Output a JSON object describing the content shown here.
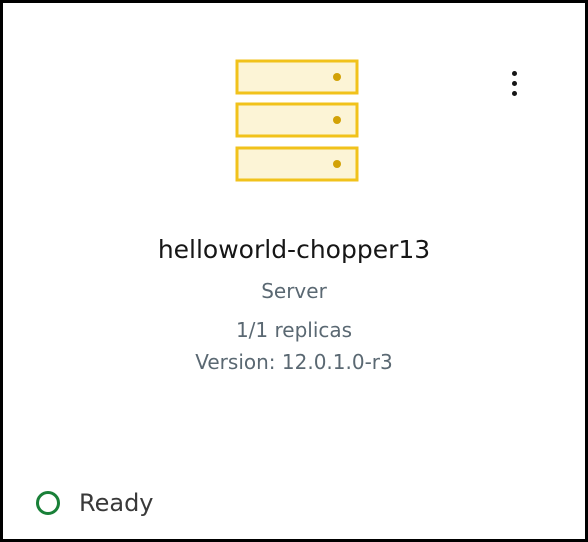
{
  "card": {
    "name": "helloworld-chopper13",
    "type": "Server",
    "replicas": "1/1 replicas",
    "version": "Version: 12.0.1.0-r3",
    "icon": "server-stack-icon",
    "menu_icon": "overflow-menu-vertical-icon",
    "status": {
      "label": "Ready",
      "icon": "status-ready-circle-icon",
      "color": "#198038"
    },
    "accent_color": "#f1c21b"
  }
}
